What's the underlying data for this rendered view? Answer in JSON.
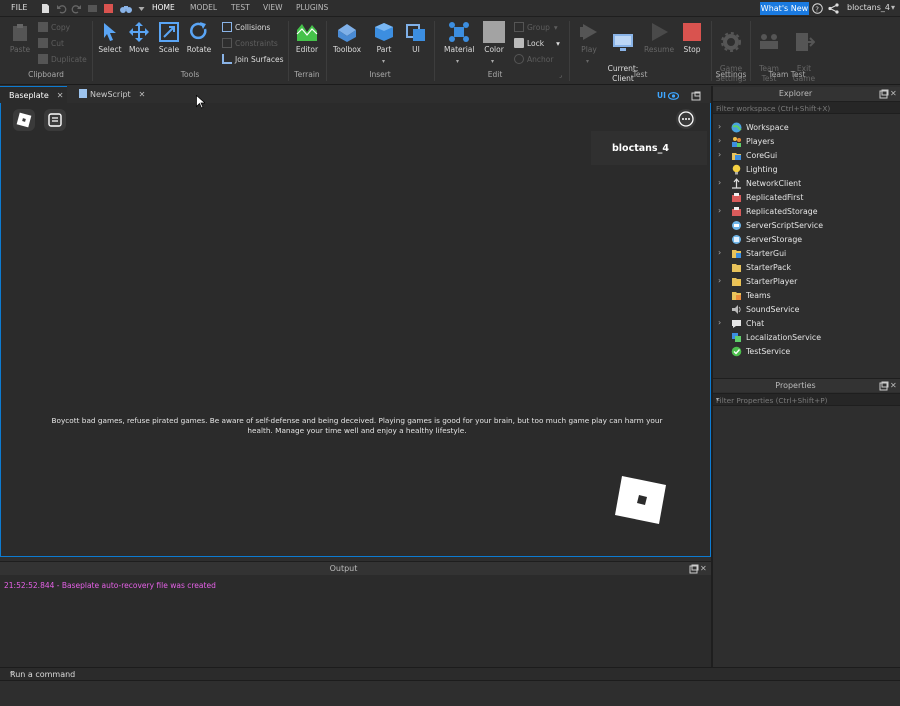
{
  "menubar": {
    "file": "FILE",
    "tabs": [
      "HOME",
      "MODEL",
      "TEST",
      "VIEW",
      "PLUGINS"
    ],
    "whats_new": "What's New",
    "username": "bloctans_4"
  },
  "ribbon": {
    "clipboard": {
      "paste": "Paste",
      "copy": "Copy",
      "cut": "Cut",
      "duplicate": "Duplicate",
      "group": "Clipboard"
    },
    "tools": {
      "select": "Select",
      "move": "Move",
      "scale": "Scale",
      "rotate": "Rotate",
      "collisions": "Collisions",
      "constraints": "Constraints",
      "join_surfaces": "Join Surfaces",
      "group": "Tools"
    },
    "terrain": {
      "editor": "Editor",
      "group": "Terrain"
    },
    "insert": {
      "toolbox": "Toolbox",
      "part": "Part",
      "ui": "UI",
      "group": "Insert"
    },
    "edit": {
      "material": "Material",
      "color": "Color",
      "group_btn": "Group",
      "lock": "Lock",
      "anchor": "Anchor",
      "group": "Edit"
    },
    "test": {
      "play": "Play",
      "current_client": "Current:\nClient",
      "resume": "Resume",
      "stop": "Stop",
      "group": "Test"
    },
    "settings": {
      "game_settings": "Game\nSettings",
      "group": "Settings"
    },
    "team_test": {
      "team_test": "Team\nTest",
      "exit_game": "Exit\nGame",
      "group": "Team Test"
    },
    "colors": {
      "accent": "#0d7bd1",
      "stop": "#d9534f",
      "terrain": "#45c24a"
    }
  },
  "tabs": [
    {
      "label": "Baseplate",
      "active": true
    },
    {
      "label": "NewScript",
      "active": false
    }
  ],
  "viewport": {
    "ui_toggle": "UI",
    "player_name": "bloctans_4",
    "notice": "Boycott bad games, refuse pirated games. Be aware of self-defense and being deceived. Playing games is good for your brain, but too much game play can harm your health. Manage your time well and enjoy a healthy lifestyle."
  },
  "output": {
    "title": "Output",
    "lines": [
      "21:52:52.844 - Baseplate auto-recovery file was created"
    ],
    "command_placeholder": "Run a command"
  },
  "explorer": {
    "title": "Explorer",
    "filter_placeholder": "Filter workspace (Ctrl+Shift+X)",
    "items": [
      {
        "label": "Workspace",
        "expandable": true,
        "icon": "globe-icon"
      },
      {
        "label": "Players",
        "expandable": true,
        "icon": "players-icon"
      },
      {
        "label": "CoreGui",
        "expandable": true,
        "icon": "coregui-icon"
      },
      {
        "label": "Lighting",
        "expandable": false,
        "icon": "lightbulb-icon"
      },
      {
        "label": "NetworkClient",
        "expandable": true,
        "icon": "network-icon"
      },
      {
        "label": "ReplicatedFirst",
        "expandable": false,
        "icon": "replicated-first-icon"
      },
      {
        "label": "ReplicatedStorage",
        "expandable": true,
        "icon": "replicated-storage-icon"
      },
      {
        "label": "ServerScriptService",
        "expandable": false,
        "icon": "server-script-icon"
      },
      {
        "label": "ServerStorage",
        "expandable": false,
        "icon": "server-storage-icon"
      },
      {
        "label": "StarterGui",
        "expandable": true,
        "icon": "folder-icon"
      },
      {
        "label": "StarterPack",
        "expandable": false,
        "icon": "folder-icon"
      },
      {
        "label": "StarterPlayer",
        "expandable": true,
        "icon": "folder-icon"
      },
      {
        "label": "Teams",
        "expandable": false,
        "icon": "folder-icon"
      },
      {
        "label": "SoundService",
        "expandable": false,
        "icon": "sound-icon"
      },
      {
        "label": "Chat",
        "expandable": true,
        "icon": "chat-icon"
      },
      {
        "label": "LocalizationService",
        "expandable": false,
        "icon": "localization-icon"
      },
      {
        "label": "TestService",
        "expandable": false,
        "icon": "check-icon"
      }
    ]
  },
  "properties": {
    "title": "Properties",
    "filter_placeholder": "Filter Properties (Ctrl+Shift+P)"
  }
}
